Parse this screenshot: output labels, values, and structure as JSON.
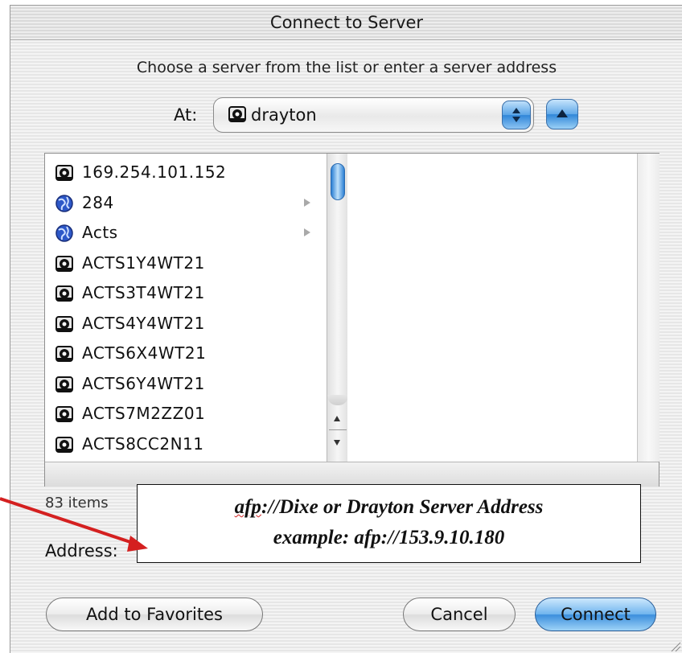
{
  "window": {
    "title": "Connect to Server"
  },
  "prompt": "Choose a server from the list or enter a server address",
  "location": {
    "label": "At:",
    "selected": "drayton"
  },
  "server_list": {
    "items": [
      {
        "label": "169.254.101.152",
        "icon": "server-icon",
        "has_children": false
      },
      {
        "label": "284",
        "icon": "network-globe-icon",
        "has_children": true
      },
      {
        "label": "Acts",
        "icon": "network-globe-icon",
        "has_children": true
      },
      {
        "label": "ACTS1Y4WT21",
        "icon": "server-icon",
        "has_children": false
      },
      {
        "label": "ACTS3T4WT21",
        "icon": "server-icon",
        "has_children": false
      },
      {
        "label": "ACTS4Y4WT21",
        "icon": "server-icon",
        "has_children": false
      },
      {
        "label": "ACTS6X4WT21",
        "icon": "server-icon",
        "has_children": false
      },
      {
        "label": "ACTS6Y4WT21",
        "icon": "server-icon",
        "has_children": false
      },
      {
        "label": "ACTS7M2ZZ01",
        "icon": "server-icon",
        "has_children": false
      },
      {
        "label": "ACTS8CC2N11",
        "icon": "server-icon",
        "has_children": false
      }
    ],
    "count_label": "83 items"
  },
  "address": {
    "label": "Address:",
    "line1_prefix": "afp",
    "line1_rest": "://Dixe or Drayton Server Address",
    "line2": "example: afp://153.9.10.180"
  },
  "buttons": {
    "add_favorites": "Add to Favorites",
    "cancel": "Cancel",
    "connect": "Connect"
  },
  "colors": {
    "accent_blue": "#3a8edc",
    "annotation_arrow": "#d42020"
  }
}
